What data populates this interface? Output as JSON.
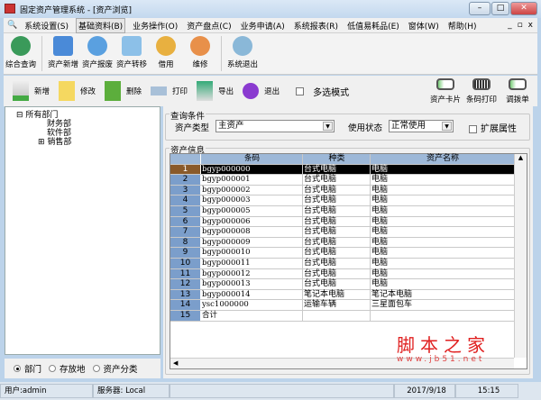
{
  "window": {
    "title": "固定资产管理系统 - [资产浏览]",
    "minimize": "–",
    "maximize": "□",
    "close": "✕"
  },
  "menu": [
    "系统设置(S)",
    "基础资料(B)",
    "业务操作(O)",
    "资产盘点(C)",
    "业务申请(A)",
    "系统报表(R)",
    "低值易耗品(E)",
    "窗体(W)",
    "帮助(H)"
  ],
  "mdi": {
    "min": "_",
    "restore": "▫",
    "close": "x"
  },
  "toolbar1": [
    "综合查询",
    "资产新增",
    "资产报废",
    "资产转移",
    "借用",
    "维修",
    "系统退出"
  ],
  "toolbar2": {
    "add": "新增",
    "edit": "修改",
    "delete": "删除",
    "print": "打印",
    "export": "导出",
    "exit": "退出",
    "multi": "多选模式",
    "card": "资产卡片",
    "barcode": "条码打印",
    "transfer": "调拨单"
  },
  "tree": {
    "root": "所有部门",
    "children": [
      "财务部",
      "软件部",
      "销售部"
    ]
  },
  "radios": [
    "部门",
    "存放地",
    "资产分类"
  ],
  "query": {
    "label": "查询条件",
    "type_label": "资产类型",
    "type_value": "主资产",
    "status_label": "使用状态",
    "status_value": "正常使用",
    "ext": "扩展属性"
  },
  "grid": {
    "label": "资产信息",
    "headers": [
      "条码",
      "种类",
      "资产名称"
    ],
    "rows": [
      [
        "1",
        "bgyp000000",
        "台式电脑",
        "电脑"
      ],
      [
        "2",
        "bgyp000001",
        "台式电脑",
        "电脑"
      ],
      [
        "3",
        "bgyp000002",
        "台式电脑",
        "电脑"
      ],
      [
        "4",
        "bgyp000003",
        "台式电脑",
        "电脑"
      ],
      [
        "5",
        "bgyp000005",
        "台式电脑",
        "电脑"
      ],
      [
        "6",
        "bgyp000006",
        "台式电脑",
        "电脑"
      ],
      [
        "7",
        "bgyp000008",
        "台式电脑",
        "电脑"
      ],
      [
        "8",
        "bgyp000009",
        "台式电脑",
        "电脑"
      ],
      [
        "9",
        "bgyp000010",
        "台式电脑",
        "电脑"
      ],
      [
        "10",
        "bgyp000011",
        "台式电脑",
        "电脑"
      ],
      [
        "11",
        "bgyp000012",
        "台式电脑",
        "电脑"
      ],
      [
        "12",
        "bgyp000013",
        "台式电脑",
        "电脑"
      ],
      [
        "13",
        "bgyp000014",
        "笔记本电脑",
        "笔记本电脑"
      ],
      [
        "14",
        "ysc1000000",
        "运输车辆",
        "三星面包车"
      ],
      [
        "15",
        "合计",
        "",
        ""
      ]
    ]
  },
  "watermark": {
    "text": "脚本之家",
    "url": "www.jb51.net"
  },
  "status": {
    "user": "用户:admin",
    "server": "服务器: Local",
    "date": "2017/9/18",
    "time": "15:15"
  }
}
